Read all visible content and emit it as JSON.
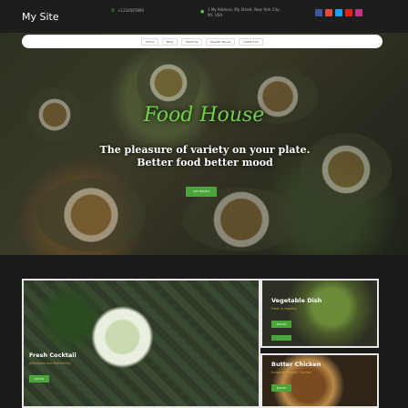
{
  "header": {
    "site_title": "My Site",
    "phone": "+1234567890",
    "address": "1 My Address, My Street, New York City, NY, USA",
    "social": [
      {
        "name": "facebook",
        "color": "#3b5998"
      },
      {
        "name": "google-plus",
        "color": "#dd4b39"
      },
      {
        "name": "twitter",
        "color": "#1da1f2"
      },
      {
        "name": "youtube",
        "color": "#e62117"
      },
      {
        "name": "instagram",
        "color": "#c13584"
      }
    ]
  },
  "nav": {
    "items": [
      "Home",
      "Blog",
      "About Us",
      "Popular Menus",
      "Contact Us"
    ]
  },
  "hero": {
    "title": "Food House",
    "tagline": "The pleasure of variety on your plate. Better food better mood",
    "cta": "Get Started"
  },
  "cards": [
    {
      "name": "Vegetable Dish",
      "subtitle": "Fresh & Healthy",
      "price": "$30.00"
    },
    {
      "name": "Fresh Cocktail",
      "subtitle": "Affordable and Refreshing",
      "price": "$15.00"
    },
    {
      "name": "Butter Chicken",
      "subtitle": "Amazing Buttery Chicken",
      "price": "$45.00"
    }
  ],
  "colors": {
    "accent": "#4aa63a",
    "header_bg": "#1c1d1c",
    "hero_title": "#6fd04a"
  }
}
